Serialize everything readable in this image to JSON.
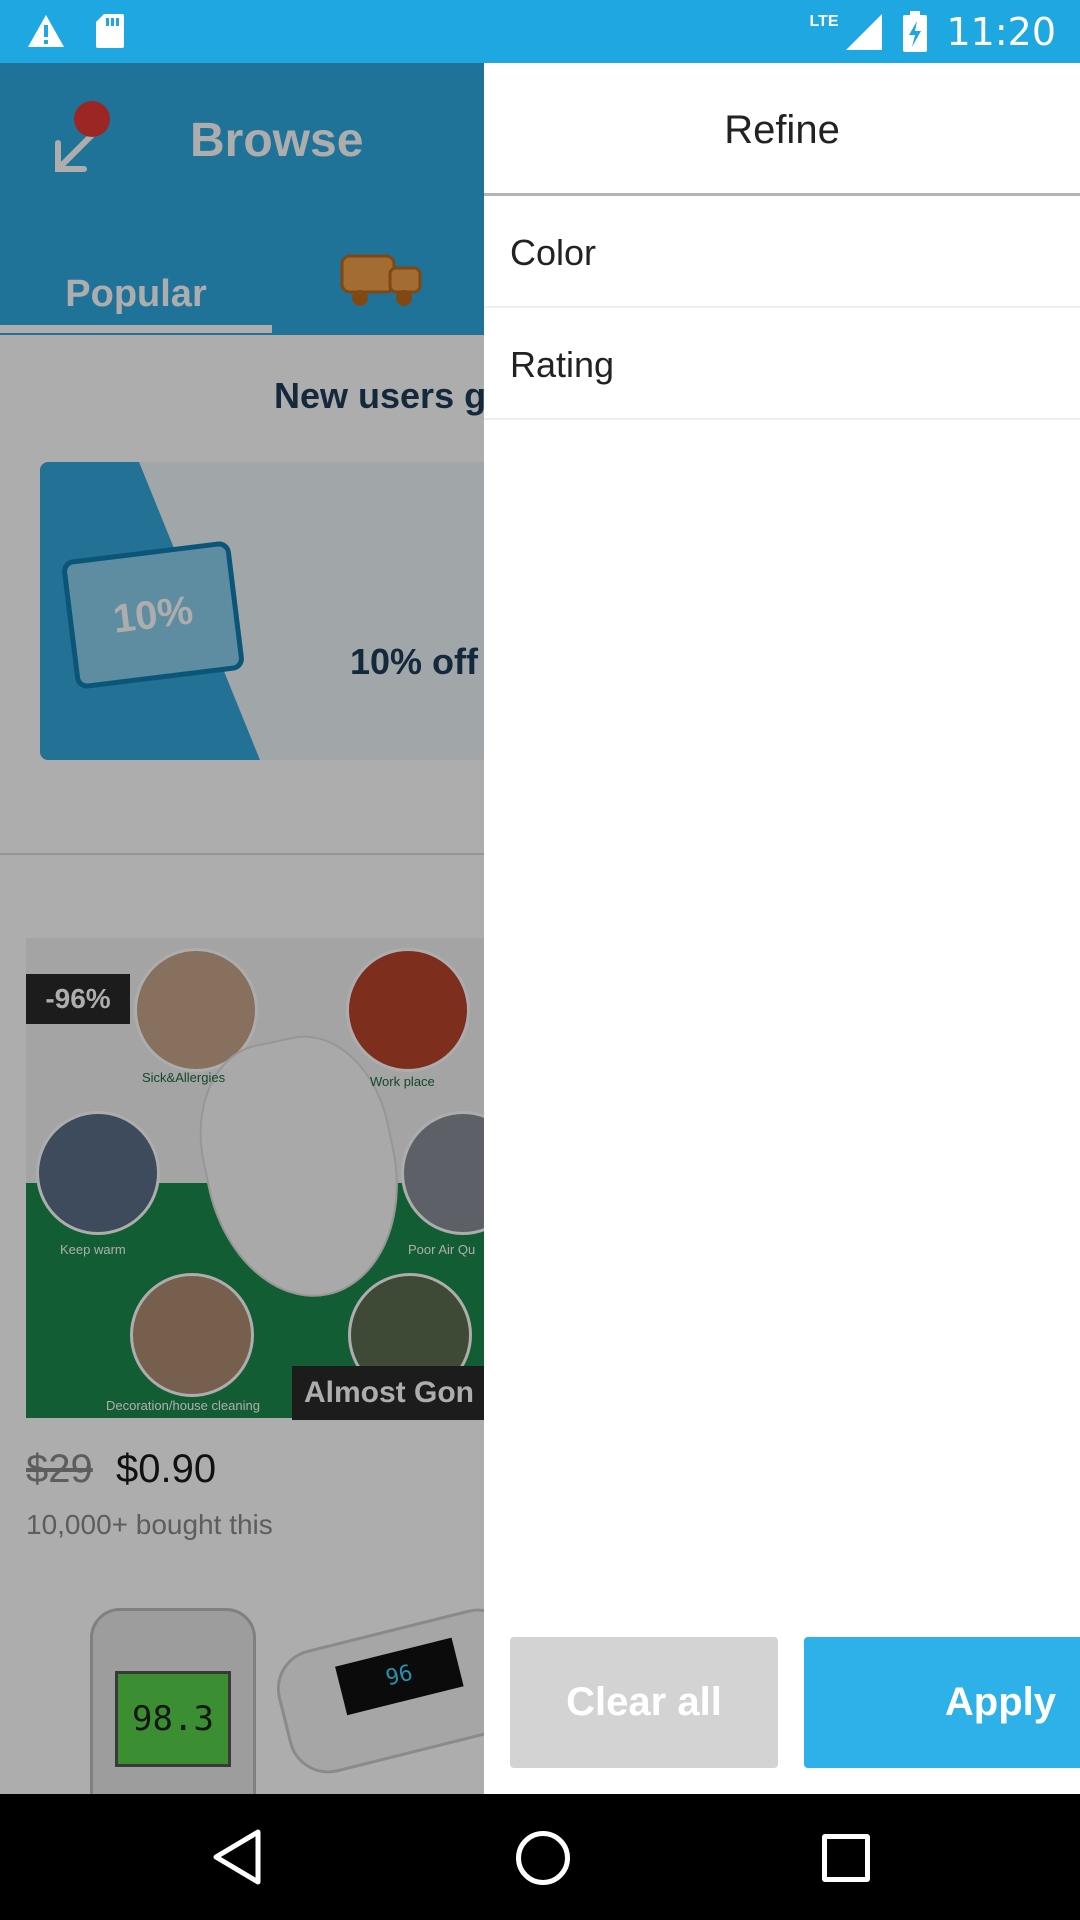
{
  "status_bar": {
    "time": "11:20",
    "network": "LTE",
    "icons": [
      "warning-icon",
      "sd-card-icon",
      "signal-icon",
      "battery-charging-icon"
    ]
  },
  "app": {
    "title": "Browse",
    "tabs": [
      {
        "label": "Popular",
        "selected": true
      }
    ],
    "banner_heading": "New users g",
    "promo": {
      "ticket_text": "10%",
      "text": "10% off"
    },
    "product": {
      "discount": "-96%",
      "status": "Almost Gon",
      "old_price": "$29",
      "price": "$0.90",
      "bought": "10,000+ bought this",
      "captions": [
        "Sick&Allergies",
        "Work place",
        "Keep warm",
        "Poor Air Qu",
        "Decoration/house cleaning"
      ]
    },
    "product2": {
      "thermo_reading": "98.3",
      "oxi_reading": "96"
    }
  },
  "drawer": {
    "title": "Refine",
    "filters": [
      "Color",
      "Rating"
    ],
    "clear_label": "Clear all",
    "apply_label": "Apply"
  },
  "colors": {
    "status_bar": "#1ea7e1",
    "app_bar": "#2fa8e0",
    "apply_button": "#2eb0e9",
    "clear_button": "#d3d3d3"
  }
}
